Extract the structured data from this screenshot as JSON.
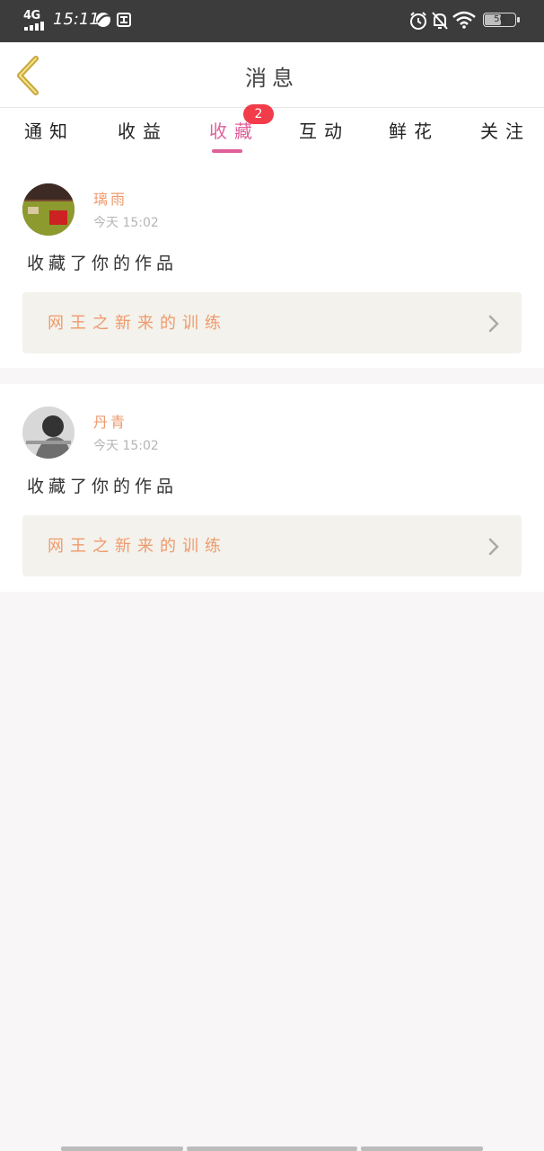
{
  "status_bar": {
    "network": "4G",
    "time": "15:11",
    "battery_level": "56",
    "battery_fraction": 0.56,
    "icons": [
      "signal-icon",
      "app-notification-icon",
      "screenshot-icon",
      "alarm-icon",
      "mute-icon",
      "wifi-icon",
      "battery-icon"
    ]
  },
  "header": {
    "title": "消息",
    "back_icon": "chevron-left-icon"
  },
  "tabs": [
    {
      "label": "通知",
      "active": false
    },
    {
      "label": "收益",
      "active": false
    },
    {
      "label": "收藏",
      "active": true,
      "badge": "2"
    },
    {
      "label": "互动",
      "active": false
    },
    {
      "label": "鲜花",
      "active": false
    },
    {
      "label": "关注",
      "active": false
    }
  ],
  "messages": [
    {
      "user": "璃雨",
      "time": "今天 15:02",
      "action": "收藏了你的作品",
      "work_title": "网王之新来的训练"
    },
    {
      "user": "丹青",
      "time": "今天 15:02",
      "action": "收藏了你的作品",
      "work_title": "网王之新来的训练"
    }
  ],
  "colors": {
    "accent": "#e0609a",
    "badge": "#f23c4a",
    "username": "#ef9a6c",
    "card_link_bg": "#f3f2ec",
    "background": "#f8f6f6"
  }
}
